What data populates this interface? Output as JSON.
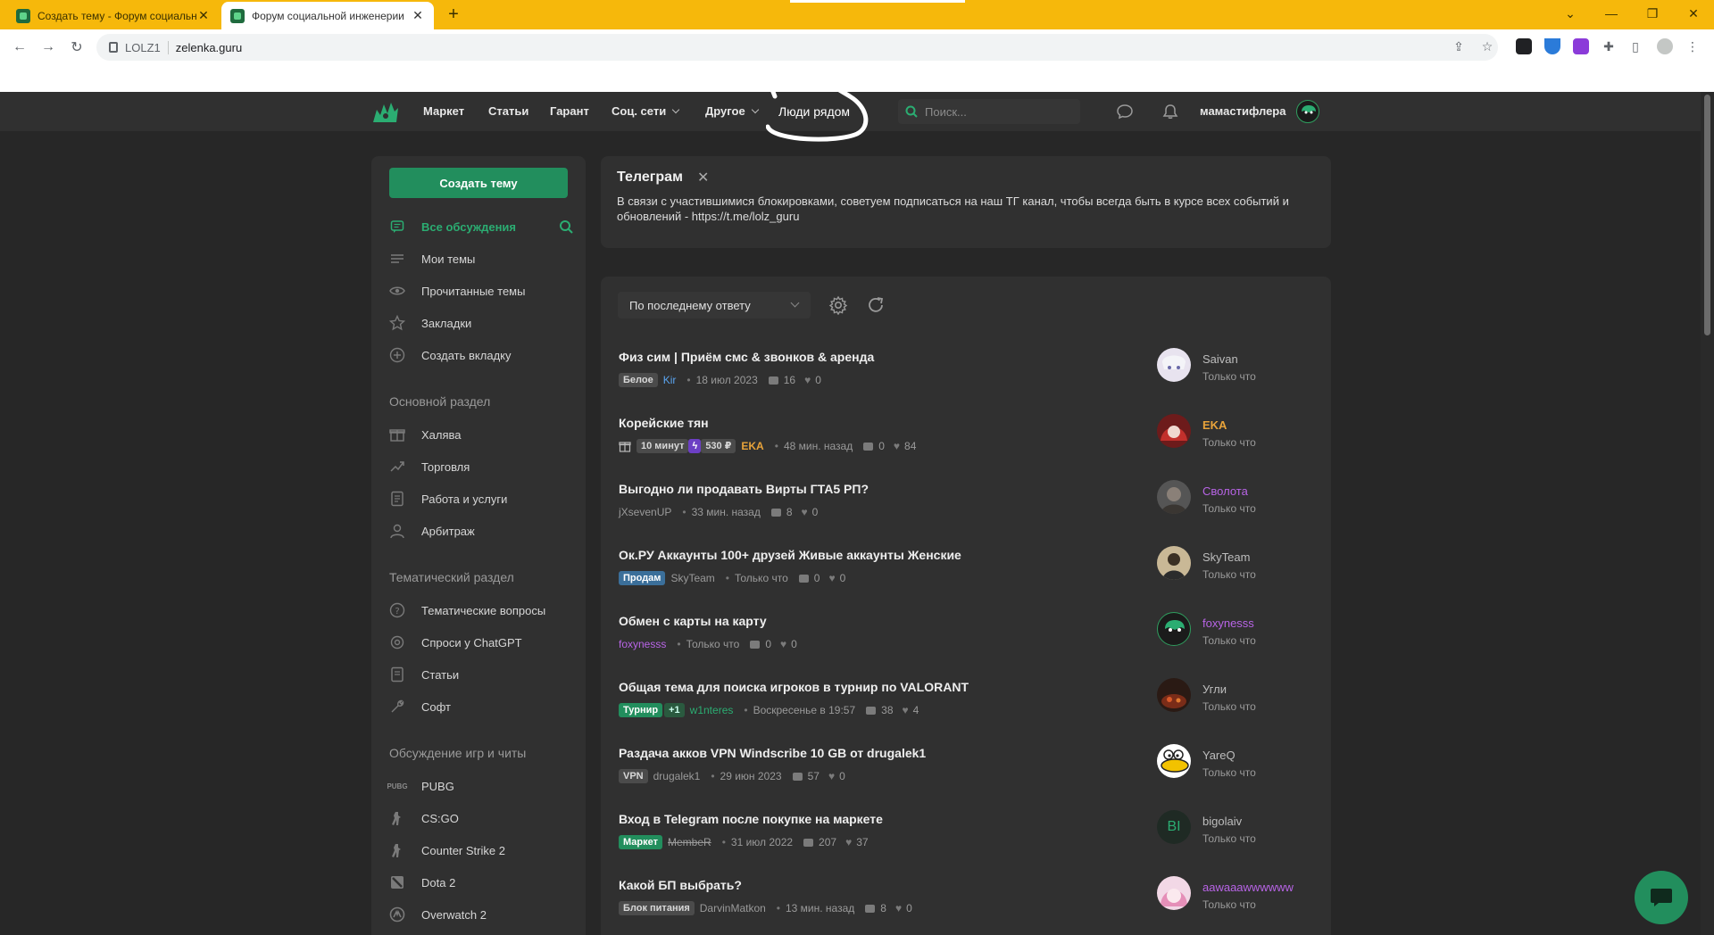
{
  "browser": {
    "tabs": [
      {
        "title": "Создать тему - Форум социальн",
        "active": false
      },
      {
        "title": "Форум социальной инженерии",
        "active": true
      }
    ],
    "address": {
      "site_chip": "LOLZ1",
      "url": "zelenka.guru"
    }
  },
  "header": {
    "nav": [
      {
        "label": "Маркет"
      },
      {
        "label": "Статьи"
      },
      {
        "label": "Гарант"
      },
      {
        "label": "Соц. сети"
      },
      {
        "label": "Другое"
      }
    ],
    "people_nearby": "Люди рядом",
    "search_placeholder": "Поиск...",
    "username": "мамастифлера"
  },
  "sidebar": {
    "create_label": "Создать тему",
    "top_items": [
      {
        "label": "Все обсуждения"
      },
      {
        "label": "Мои темы"
      },
      {
        "label": "Прочитанные темы"
      },
      {
        "label": "Закладки"
      },
      {
        "label": "Создать вкладку"
      }
    ],
    "sections": [
      {
        "heading": "Основной раздел",
        "items": [
          {
            "label": "Халява"
          },
          {
            "label": "Торговля"
          },
          {
            "label": "Работа и услуги"
          },
          {
            "label": "Арбитраж"
          }
        ]
      },
      {
        "heading": "Тематический раздел",
        "items": [
          {
            "label": "Тематические вопросы"
          },
          {
            "label": "Спроси у ChatGPT"
          },
          {
            "label": "Статьи"
          },
          {
            "label": "Софт"
          }
        ]
      },
      {
        "heading": "Обсуждение игр и читы",
        "items": [
          {
            "label": "PUBG"
          },
          {
            "label": "CS:GO"
          },
          {
            "label": "Counter Strike 2"
          },
          {
            "label": "Dota 2"
          },
          {
            "label": "Overwatch 2"
          }
        ]
      }
    ],
    "pubg_icon_text": "PUBG"
  },
  "notice": {
    "title": "Телеграм",
    "close": "✕",
    "text": "В связи с участившимися блокировками, советуем подписаться на наш ТГ канал, чтобы всегда быть в курсе всех событий и обновлений - https://t.me/lolz_guru"
  },
  "threads_panel": {
    "sort_label": "По последнему ответу",
    "threads": [
      {
        "title": "Физ сим | Приём смс & звонков & аренда",
        "prefix": "Белое",
        "author": "Kir",
        "date": "18 июл 2023",
        "replies": "16",
        "likes": "0",
        "last_user": "Saivan",
        "last_time": "Только что"
      },
      {
        "title": "Корейские тян",
        "prefix": "10 минут",
        "price": "530 ₽",
        "author": "EKA",
        "date": "48 мин. назад",
        "replies": "0",
        "likes": "84",
        "last_user": "EKA",
        "last_time": "Только что"
      },
      {
        "title": "Выгодно ли продавать Вирты ГТА5 РП?",
        "author": "jXsevenUP",
        "date": "33 мин. назад",
        "replies": "8",
        "likes": "0",
        "last_user": "Сволота",
        "last_time": "Только что"
      },
      {
        "title": "Ок.РУ Аккаунты 100+ друзей Живые аккаунты Женские",
        "prefix": "Продам",
        "author": "SkyTeam",
        "date": "Только что",
        "replies": "0",
        "likes": "0",
        "last_user": "SkyTeam",
        "last_time": "Только что"
      },
      {
        "title": "Обмен с карты на карту",
        "author": "foxynesss",
        "date": "Только что",
        "replies": "0",
        "likes": "0",
        "last_user": "foxynesss",
        "last_time": "Только что"
      },
      {
        "title": "Общая тема для поиска игроков в турнир по VALORANT",
        "prefix": "Турнир",
        "prefix_extra": "+1",
        "author": "w1nteres",
        "date": "Воскресенье в 19:57",
        "replies": "38",
        "likes": "4",
        "last_user": "Угли",
        "last_time": "Только что"
      },
      {
        "title": "Раздача акков VPN Windscribe 10 GB от drugalek1",
        "prefix": "VPN",
        "author": "drugalek1",
        "date": "29 июн 2023",
        "replies": "57",
        "likes": "0",
        "last_user": "YareQ",
        "last_time": "Только что"
      },
      {
        "title": "Вход в Telegram после покупке на маркете",
        "prefix": "Маркет",
        "author": "MembeR",
        "date": "31 июл 2022",
        "replies": "207",
        "likes": "37",
        "last_user": "bigolaiv",
        "last_initials": "BI",
        "last_time": "Только что"
      },
      {
        "title": "Какой БП выбрать?",
        "prefix": "Блок питания",
        "author": "DarvinMatkon",
        "date": "13 мин. назад",
        "replies": "8",
        "likes": "0",
        "last_user": "aawaaawwwwww",
        "last_time": "Только что"
      }
    ]
  },
  "colors": {
    "accent": "#228e5d",
    "accent_text": "#2bad72",
    "panel": "#303030",
    "background": "#272727",
    "tab_strip": "#f6b80b",
    "username_violet": "#b864e6",
    "author_blue": "#5aa4ef",
    "eka_gold": "#e8a33a"
  }
}
